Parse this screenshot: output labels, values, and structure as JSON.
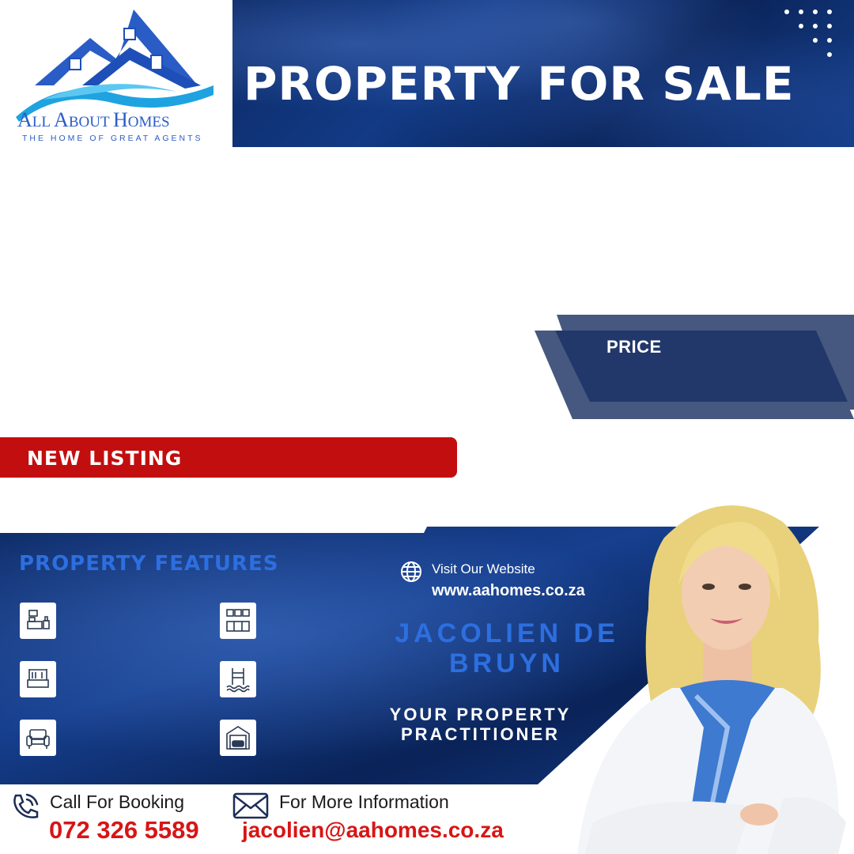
{
  "brand": {
    "name": "All About Homes",
    "name_prefix": "A",
    "name_part1": "LL ",
    "name_part2": "BOUT ",
    "name_part3": "OMES",
    "tagline": "THE HOME OF GREAT AGENTS"
  },
  "header": {
    "title": "PROPERTY FOR SALE"
  },
  "price": {
    "label": "PRICE"
  },
  "listing": {
    "badge": "NEW LISTING"
  },
  "features": {
    "title": "PROPERTY FEATURES",
    "icons": [
      "bedroom-icon",
      "kitchen-icon",
      "bathroom-icon",
      "pool-icon",
      "lounge-icon",
      "garage-icon"
    ]
  },
  "website": {
    "label": "Visit Our Website",
    "url": "www.aahomes.co.za"
  },
  "agent": {
    "name": "JACOLIEN DE BRUYN",
    "role": "YOUR PROPERTY PRACTITIONER"
  },
  "contact": {
    "call_label": "Call For Booking",
    "phone": "072 326 5589",
    "info_label": "For More Information",
    "email": "jacolien@aahomes.co.za"
  },
  "colors": {
    "navy": "#0d2a66",
    "accent_blue": "#2d6fe0",
    "red": "#c20e0e",
    "price_dark": "#22386a",
    "price_light": "#46587f"
  }
}
